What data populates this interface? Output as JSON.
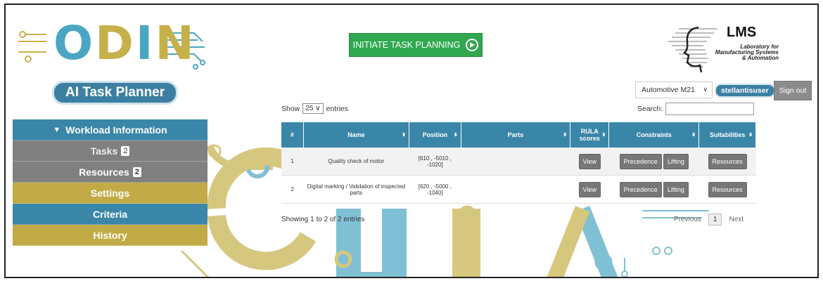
{
  "logo": {
    "text_part1": "O",
    "text_part2": "D",
    "text_part3": "I",
    "text_part4": "N"
  },
  "app_title": "AI Task Planner",
  "initiate_label": "INITIATE TASK PLANNING",
  "lms": {
    "title": "LMS",
    "subtitle_line1": "Laboratory for",
    "subtitle_line2": "Manufacturing Systems",
    "subtitle_line3": "& Automation"
  },
  "project_select": {
    "value": "Automotive M21"
  },
  "user": "stellantisuser",
  "signout": "Sign out",
  "sidebar": {
    "header": "Workload Information",
    "items": [
      {
        "label": "Tasks",
        "badge": "2"
      },
      {
        "label": "Resources",
        "badge": "2"
      },
      {
        "label": "Settings"
      },
      {
        "label": "Criteria"
      },
      {
        "label": "History"
      }
    ]
  },
  "table_controls": {
    "show": "Show",
    "length": "25",
    "entries": "entries",
    "search_label": "Search:"
  },
  "table": {
    "headers": [
      "#",
      "Name",
      "Position",
      "Parts",
      "RULA scores",
      "Constraints",
      "Suitabilities"
    ],
    "rows": [
      {
        "num": "1",
        "name": "Quality check of motor",
        "position": "[610 , -5010 , -1020]",
        "parts": "",
        "rula": "View",
        "precedence": "Precedence",
        "lifting": "Lifting",
        "resources": "Resources"
      },
      {
        "num": "2",
        "name": "Digital marking / Validation of inspected parts",
        "position": "[620 , -5000 , -1040]",
        "parts": "",
        "rula": "View",
        "precedence": "Precedence",
        "lifting": "Lifting",
        "resources": "Resources"
      }
    ]
  },
  "footer": {
    "showing": "Showing 1 to 2 of 2 entries",
    "previous": "Previous",
    "page": "1",
    "next": "Next"
  },
  "colors": {
    "blue": "#3a86a8",
    "gold": "#c2ab46",
    "green": "#2fa84f",
    "gray": "#808080"
  }
}
